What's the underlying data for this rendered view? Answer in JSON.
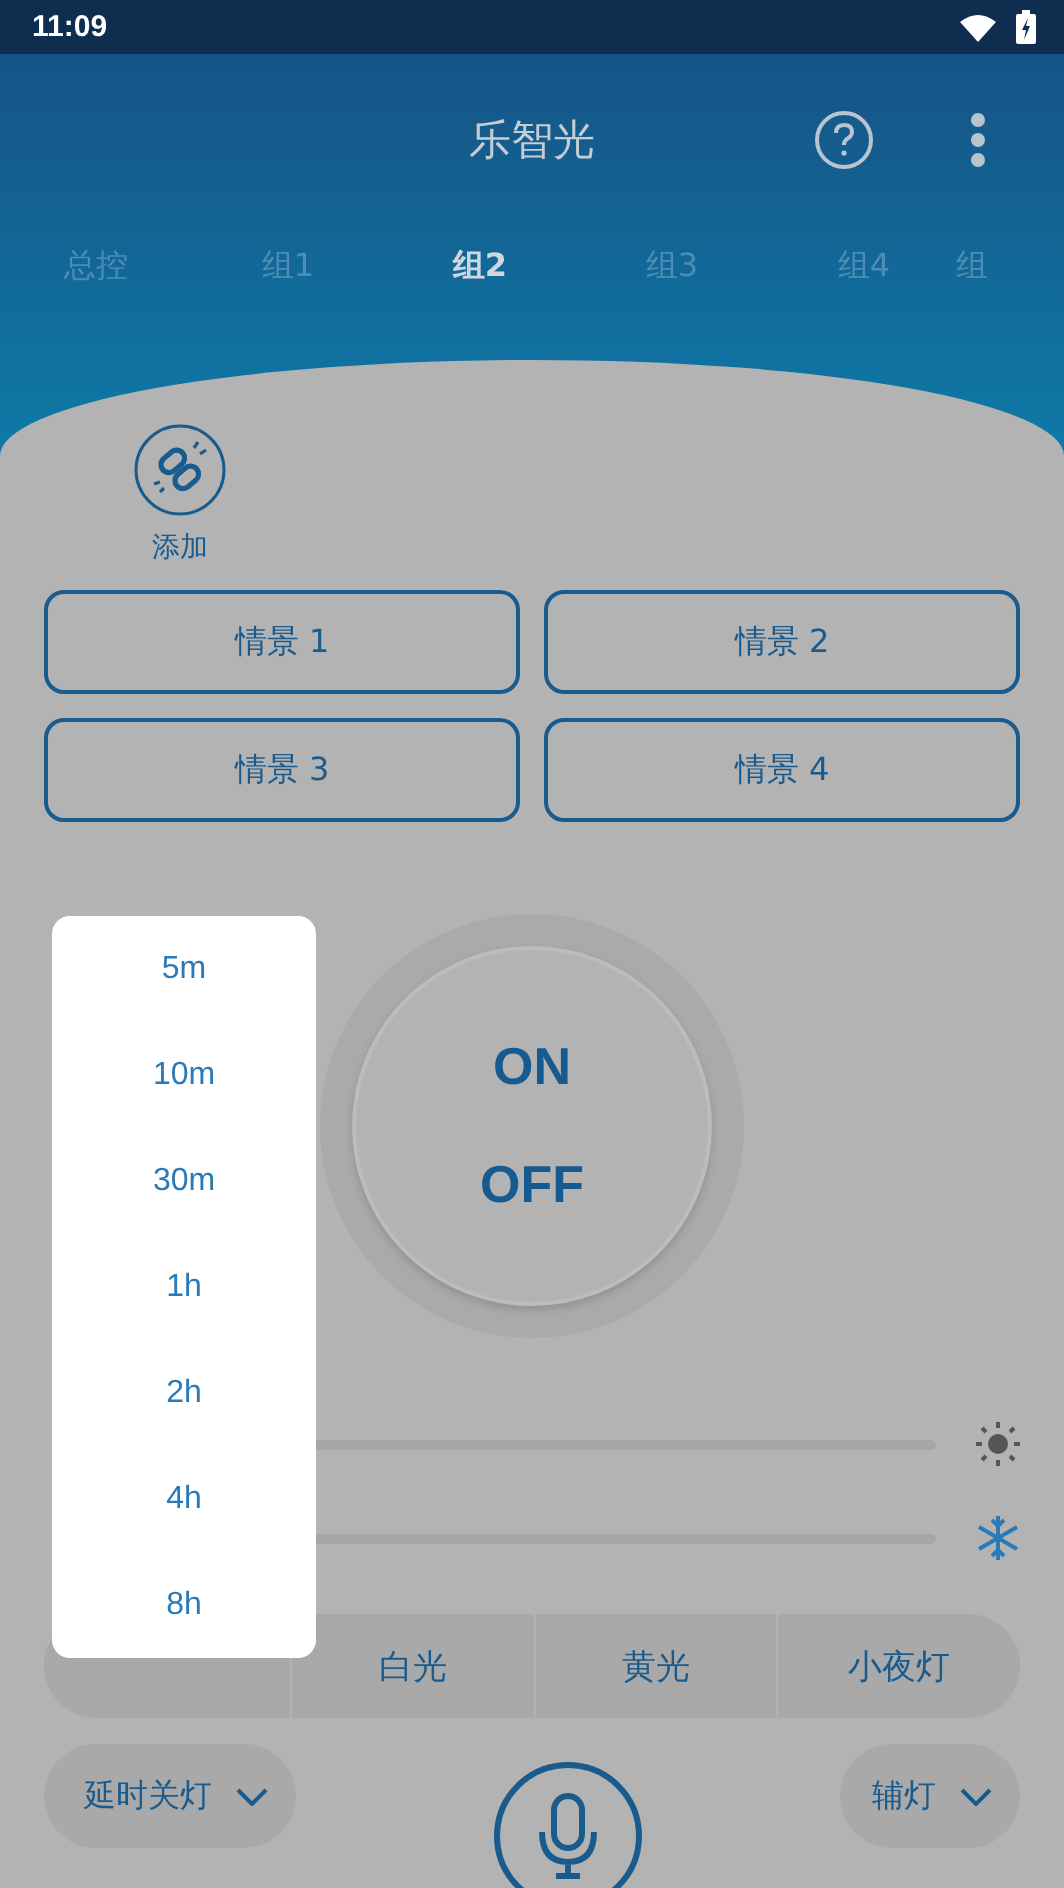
{
  "status_bar": {
    "time": "11:09"
  },
  "header": {
    "title": "乐智光"
  },
  "tabs": [
    {
      "label": "总控",
      "selected": false
    },
    {
      "label": "组1",
      "selected": false
    },
    {
      "label": "组2",
      "selected": true
    },
    {
      "label": "组3",
      "selected": false
    },
    {
      "label": "组4",
      "selected": false
    },
    {
      "label": "组",
      "selected": false
    }
  ],
  "add": {
    "label": "添加"
  },
  "scenes": [
    "情景 1",
    "情景 2",
    "情景 3",
    "情景 4"
  ],
  "power": {
    "on": "ON",
    "off": "OFF"
  },
  "sliders": [
    {
      "kind": "brightness"
    },
    {
      "kind": "temperature"
    }
  ],
  "modes": [
    "白光",
    "黄光",
    "小夜灯"
  ],
  "delay": {
    "label": "延时关灯",
    "options": [
      "5m",
      "10m",
      "30m",
      "1h",
      "2h",
      "4h",
      "8h"
    ]
  },
  "aux": {
    "label": "辅灯"
  }
}
